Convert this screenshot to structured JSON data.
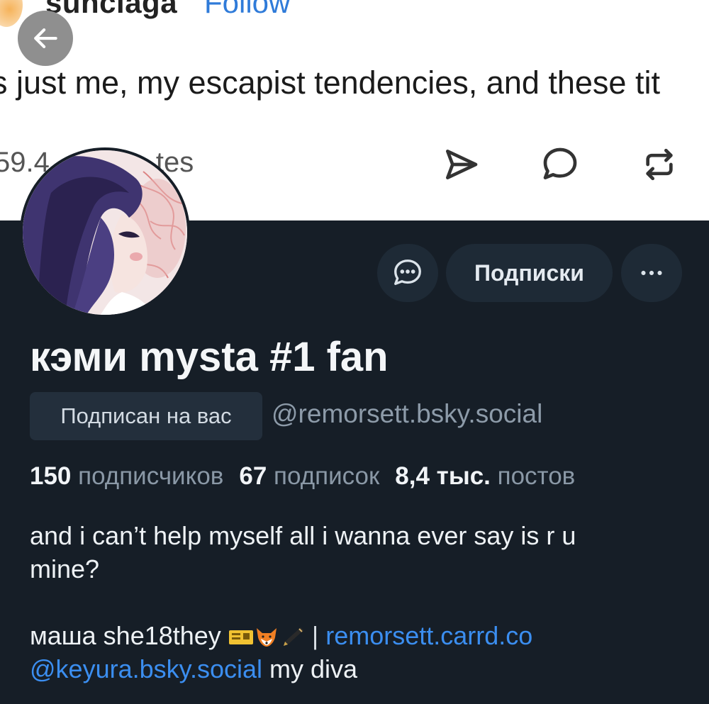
{
  "banner": {
    "username": "sunciaga",
    "follow_label": "Follow",
    "post_text": "s just me, my escapist tendencies, and these tit",
    "votes_text": "59.4",
    "votes_suffix": "tes",
    "actions": [
      "send-icon",
      "comment-icon",
      "repost-icon"
    ],
    "text_color": "#1b1b1b",
    "link_color": "#2f7bd9"
  },
  "nav": {
    "back_icon": "arrow-left-icon"
  },
  "profile": {
    "buttons": {
      "message_icon": "message-bubble-icon",
      "subscriptions_label": "Подписки",
      "more_icon": "ellipsis-icon"
    },
    "display_name": "кэми mysta #1 fan",
    "follows_you_badge": "Подписан на вас",
    "handle": "@remorsett.bsky.social",
    "stats": {
      "followers_count": "150",
      "followers_label": "подписчиков",
      "following_count": "67",
      "following_label": "подписок",
      "posts_count": "8,4 тыс.",
      "posts_label": "постов"
    },
    "bio": {
      "line1": "and i can’t help myself all i wanna ever say is r u",
      "line2": "mine?",
      "line3_text": "маша she18they",
      "emojis": [
        "ticket-icon",
        "fox-icon",
        "pen-icon"
      ],
      "separator": "|",
      "link1": "remorsett.carrd.co",
      "mention": "@keyura.bsky.social",
      "line4_tail": "my diva"
    }
  },
  "colors": {
    "background": "#161e27",
    "button_bg": "#1e2a36",
    "accent_link": "#3b8ef0",
    "muted_text": "#8a98a6",
    "primary_text": "#f1f4f7"
  }
}
